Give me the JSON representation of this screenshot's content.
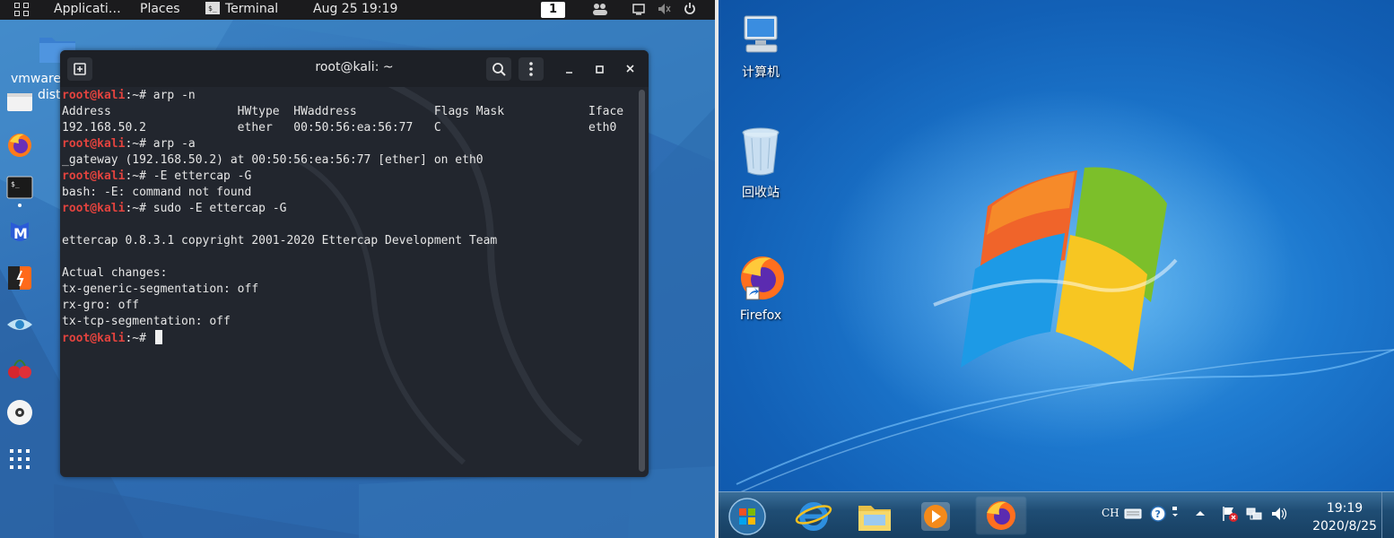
{
  "kali": {
    "topbar": {
      "applications": "Applicati…",
      "places": "Places",
      "terminal": "Terminal",
      "date": "Aug 25",
      "time": "19:19",
      "workspace": "1"
    },
    "desktop": {
      "folder_label_1": "vmware",
      "folder_label_2": "dist"
    },
    "dock_icons": [
      "files-icon",
      "firefox-icon",
      "terminal-icon",
      "metasploit-icon",
      "burpsuite-icon",
      "eye-icon",
      "cherrytree-icon",
      "disc-icon",
      "apps-grid-icon"
    ],
    "terminal": {
      "title": "root@kali: ~",
      "prompt_user": "root@kali",
      "prompt_rest": ":~# ",
      "lines": [
        {
          "type": "prompt",
          "cmd": "arp -n"
        },
        {
          "type": "out",
          "text": "Address                  HWtype  HWaddress           Flags Mask            Iface"
        },
        {
          "type": "out",
          "text": "192.168.50.2             ether   00:50:56:ea:56:77   C                     eth0"
        },
        {
          "type": "prompt",
          "cmd": "arp -a"
        },
        {
          "type": "out",
          "text": "_gateway (192.168.50.2) at 00:50:56:ea:56:77 [ether] on eth0"
        },
        {
          "type": "prompt",
          "cmd": "-E ettercap -G"
        },
        {
          "type": "out",
          "text": "bash: -E: command not found"
        },
        {
          "type": "prompt",
          "cmd": "sudo -E ettercap -G"
        },
        {
          "type": "out",
          "text": ""
        },
        {
          "type": "out",
          "text": "ettercap 0.8.3.1 copyright 2001-2020 Ettercap Development Team"
        },
        {
          "type": "out",
          "text": ""
        },
        {
          "type": "out",
          "text": "Actual changes:"
        },
        {
          "type": "out",
          "text": "tx-generic-segmentation: off"
        },
        {
          "type": "out",
          "text": "rx-gro: off"
        },
        {
          "type": "out",
          "text": "tx-tcp-segmentation: off"
        },
        {
          "type": "cursor",
          "cmd": ""
        }
      ]
    }
  },
  "windows": {
    "desktop_icons": [
      {
        "name": "computer",
        "label": "计算机"
      },
      {
        "name": "recycle-bin",
        "label": "回收站"
      },
      {
        "name": "firefox",
        "label": "Firefox"
      }
    ],
    "taskbar": {
      "apps": [
        "start-orb",
        "internet-explorer",
        "file-explorer",
        "media-player",
        "firefox"
      ],
      "lang": "CH",
      "clock_time": "19:19",
      "clock_date": "2020/8/25"
    }
  }
}
